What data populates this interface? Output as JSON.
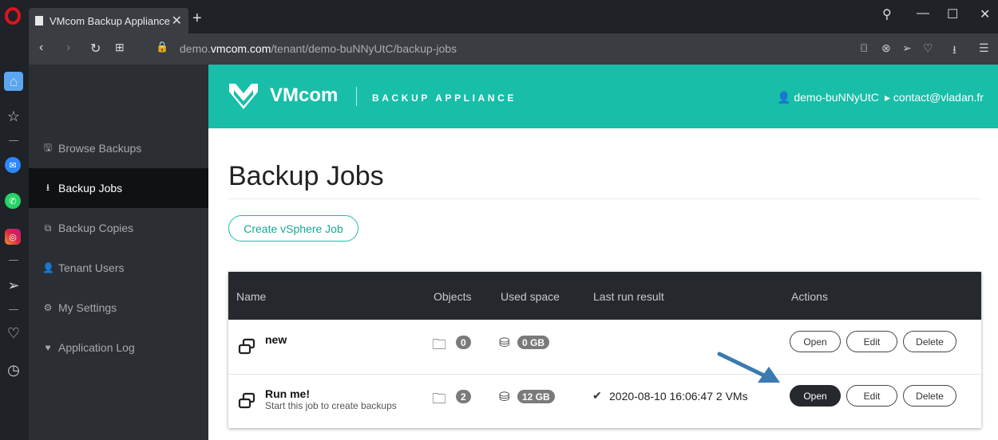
{
  "browser": {
    "tab_title": "VMcom Backup Appliance",
    "url_prefix": "demo.",
    "url_domain": "vmcom.com",
    "url_path": "/tenant/demo-buNNyUtC/backup-jobs"
  },
  "header": {
    "brand": "VMcom",
    "subtitle": "BACKUP APPLIANCE",
    "user": "demo-buNNyUtC",
    "contact": "contact@vladan.fr"
  },
  "sidebar": {
    "items": [
      {
        "label": "Browse Backups",
        "icon": "save-icon",
        "glyph": "🖫",
        "active": false
      },
      {
        "label": "Backup Jobs",
        "icon": "download-icon",
        "glyph": "⭳",
        "active": true
      },
      {
        "label": "Backup Copies",
        "icon": "copy-icon",
        "glyph": "⧉",
        "active": false
      },
      {
        "label": "Tenant Users",
        "icon": "user-icon",
        "glyph": "👤",
        "active": false
      },
      {
        "label": "My Settings",
        "icon": "gear-icon",
        "glyph": "⚙",
        "active": false
      },
      {
        "label": "Application Log",
        "icon": "heartbeat-icon",
        "glyph": "♥",
        "active": false
      }
    ]
  },
  "main": {
    "title": "Backup Jobs",
    "create_button": "Create vSphere Job",
    "columns": [
      "Name",
      "Objects",
      "Used space",
      "Last run result",
      "Actions"
    ],
    "rows": [
      {
        "name": "new",
        "description": "",
        "objects": "0",
        "used": "0 GB",
        "last_run": "",
        "actions": [
          "Open",
          "Edit",
          "Delete"
        ]
      },
      {
        "name": "Run me!",
        "description": "Start this job to create backups",
        "objects": "2",
        "used": "12 GB",
        "last_run": "2020-08-10 16:06:47  2 VMs",
        "actions": [
          "Open",
          "Edit",
          "Delete"
        ]
      }
    ]
  },
  "colors": {
    "accent": "#18bea8",
    "dark": "#25292e",
    "arrow": "#3a7ab0"
  }
}
